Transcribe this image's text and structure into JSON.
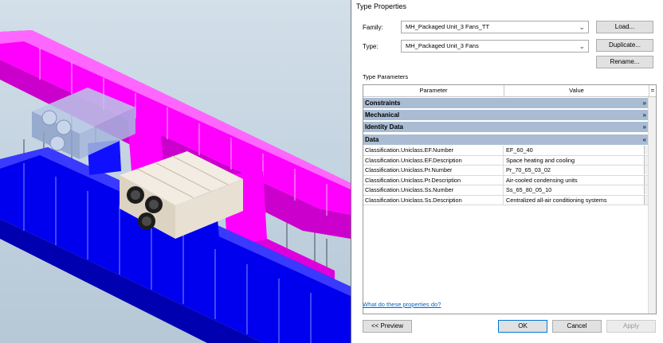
{
  "dialog": {
    "title": "Type Properties",
    "family_label": "Family:",
    "family_value": "MH_Packaged Unit_3 Fans_TT",
    "type_label": "Type:",
    "type_value": "MH_Packaged Unit_3 Fans",
    "load_button": "Load...",
    "duplicate_button": "Duplicate...",
    "rename_button": "Rename...",
    "type_parameters_label": "Type Parameters",
    "columns": {
      "parameter": "Parameter",
      "value": "Value",
      "sort": "="
    },
    "groups": [
      {
        "name": "Constraints",
        "chevron": "»"
      },
      {
        "name": "Mechanical",
        "chevron": "»"
      },
      {
        "name": "Identity Data",
        "chevron": "»"
      },
      {
        "name": "Data",
        "chevron": "«"
      }
    ],
    "rows": [
      {
        "parameter": "Classification.Uniclass.EF.Number",
        "value": "EF_60_40"
      },
      {
        "parameter": "Classification.Uniclass.EF.Description",
        "value": "Space heating and cooling"
      },
      {
        "parameter": "Classification.Uniclass.Pr.Number",
        "value": "Pr_70_65_03_02"
      },
      {
        "parameter": "Classification.Uniclass.Pr.Description",
        "value": "Air-cooled condensing units"
      },
      {
        "parameter": "Classification.Uniclass.Ss.Number",
        "value": "Ss_65_80_05_10"
      },
      {
        "parameter": "Classification.Uniclass.Ss.Description",
        "value": "Centralized all-air conditioning systems"
      }
    ],
    "help_link": "What do these properties do?",
    "preview_button": "<< Preview",
    "ok_button": "OK",
    "cancel_button": "Cancel",
    "apply_button": "Apply"
  },
  "colors": {
    "duct_magenta": "#ff00ff",
    "duct_blue": "#0000ee",
    "group_header": "#a9bcd3",
    "link": "#0066cc"
  }
}
